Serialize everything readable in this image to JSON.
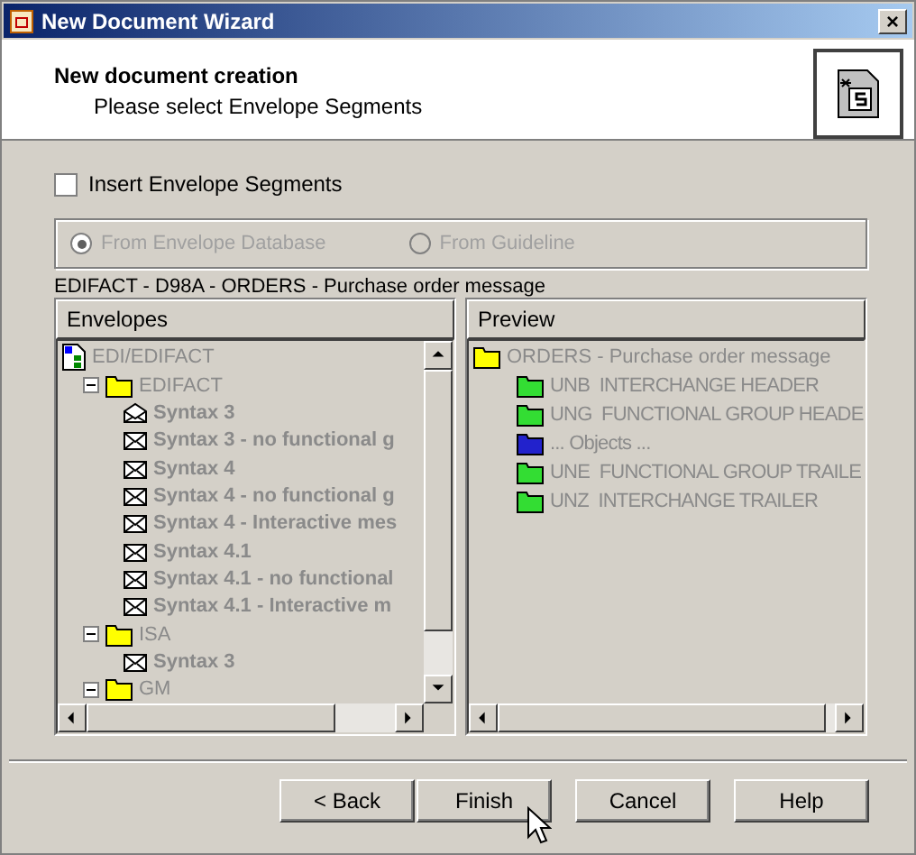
{
  "window": {
    "title": "New Document Wizard",
    "close": "×"
  },
  "header": {
    "title": "New document creation",
    "subtitle": "Please select Envelope Segments"
  },
  "insert_checkbox": {
    "label": "Insert Envelope Segments",
    "checked": false
  },
  "source": {
    "disabled": true,
    "options": [
      {
        "label": "From Envelope Database",
        "selected": true
      },
      {
        "label": "From Guideline",
        "selected": false
      }
    ]
  },
  "message_label": "EDIFACT - D98A - ORDERS - Purchase order message",
  "envelopes": {
    "heading": "Envelopes",
    "disabled": true,
    "items": [
      {
        "label": "EDI/EDIFACT",
        "kind": "root",
        "children": [
          {
            "label": "EDIFACT",
            "kind": "folder",
            "expanded": true,
            "children": [
              {
                "label": "Syntax 3",
                "kind": "open-envelope"
              },
              {
                "label": "Syntax 3 - no functional g",
                "kind": "envelope"
              },
              {
                "label": "Syntax 4",
                "kind": "envelope"
              },
              {
                "label": "Syntax 4 - no functional g",
                "kind": "envelope"
              },
              {
                "label": "Syntax 4 - Interactive mes",
                "kind": "envelope"
              },
              {
                "label": "Syntax 4.1",
                "kind": "envelope"
              },
              {
                "label": "Syntax 4.1 - no functional",
                "kind": "envelope"
              },
              {
                "label": "Syntax 4.1 - Interactive m",
                "kind": "envelope"
              }
            ]
          },
          {
            "label": "ISA",
            "kind": "folder",
            "expanded": true,
            "children": [
              {
                "label": "Syntax 3",
                "kind": "envelope"
              }
            ]
          },
          {
            "label": "GM",
            "kind": "folder",
            "expanded": true
          }
        ]
      }
    ]
  },
  "preview": {
    "heading": "Preview",
    "disabled": true,
    "items": [
      {
        "label": "ORDERS - Purchase order message",
        "color": "#ffff00",
        "children": [
          {
            "label": "UNB  INTERCHANGE HEADER",
            "color": "#33dd33"
          },
          {
            "label": "UNG  FUNCTIONAL GROUP HEADE",
            "color": "#33dd33"
          },
          {
            "label": "... Objects ...",
            "color": "#2222cc"
          },
          {
            "label": "UNE  FUNCTIONAL GROUP TRAILE",
            "color": "#33dd33"
          },
          {
            "label": "UNZ  INTERCHANGE TRAILER",
            "color": "#33dd33"
          }
        ]
      }
    ]
  },
  "buttons": [
    {
      "label": "< Back"
    },
    {
      "label": "Finish"
    },
    {
      "label": "Cancel"
    },
    {
      "label": "Help"
    }
  ]
}
